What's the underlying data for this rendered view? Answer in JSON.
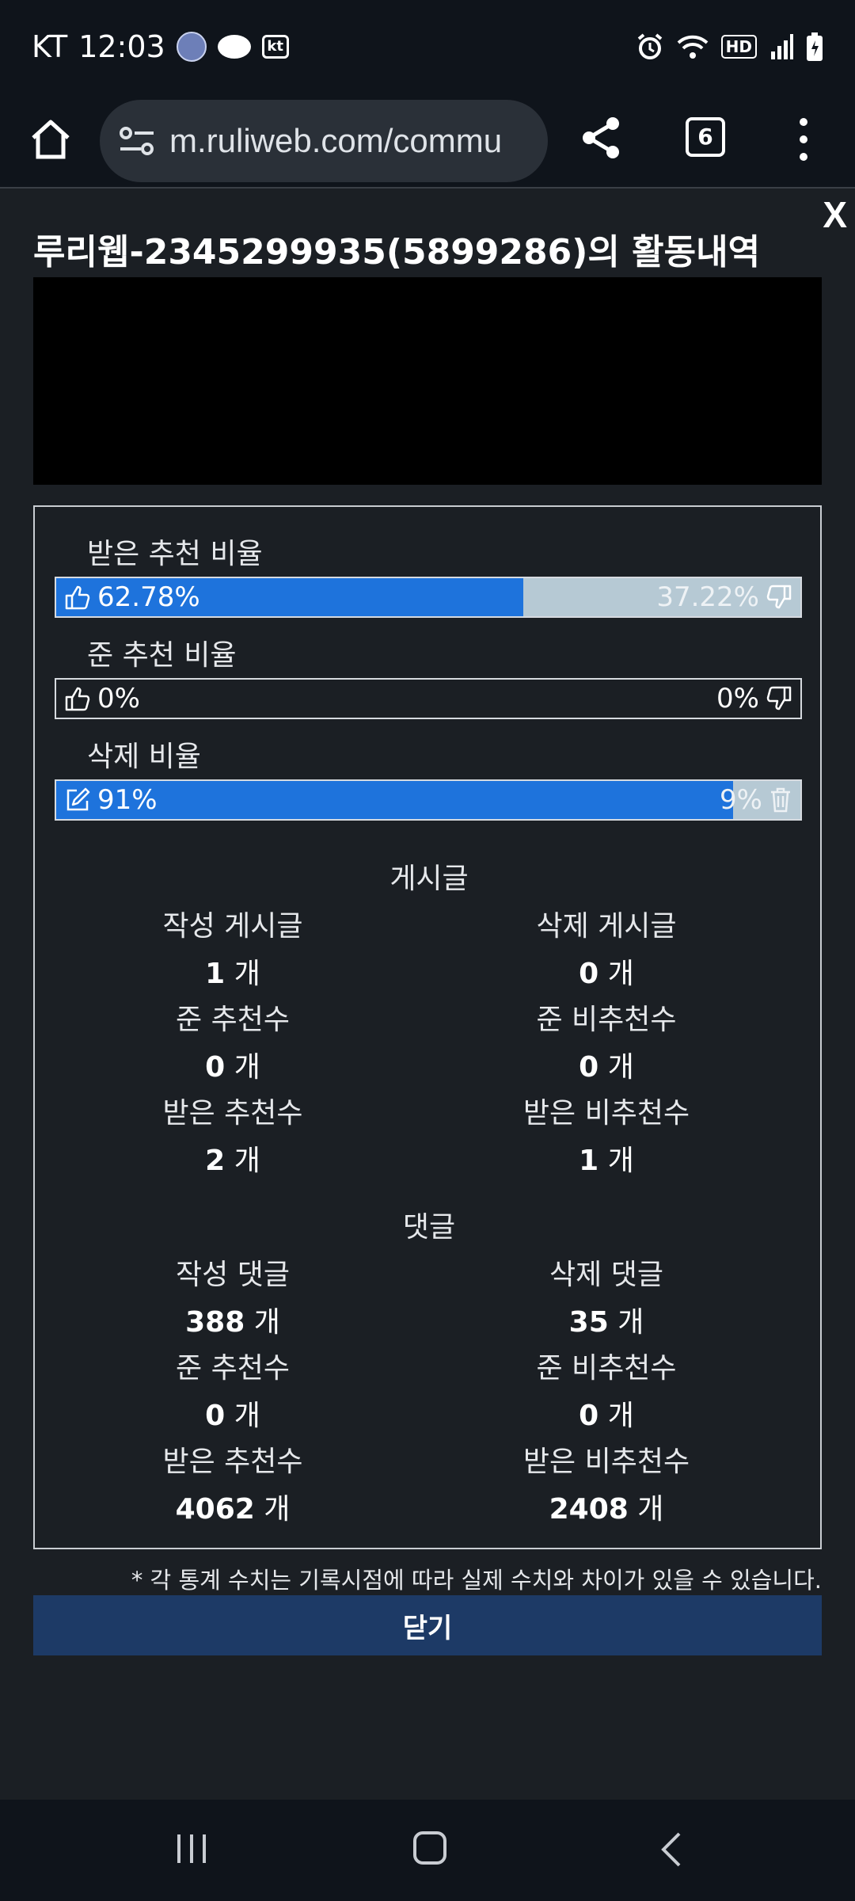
{
  "status_bar": {
    "carrier": "KT",
    "time": "12:03",
    "hd_badge": "HD",
    "kt_badge": "kt",
    "icons": [
      "avatar-icon",
      "message-icon",
      "kt-icon",
      "alarm-icon",
      "wifi-icon",
      "hd-icon",
      "signal-icon",
      "battery-icon"
    ]
  },
  "browser": {
    "url": "m.ruliweb.com/commu",
    "tab_count": "6",
    "icons": [
      "home-icon",
      "site-settings-icon",
      "share-icon",
      "tabs-icon",
      "more-menu-icon"
    ]
  },
  "popup": {
    "close_label": "X",
    "title": "루리웹-2345299935(5899286)의 활동내역",
    "ratios": [
      {
        "label": "받은 추천 비율",
        "left_value": "62.78%",
        "right_value": "37.22%",
        "left_fraction": 0.6278,
        "right_fraction": 0.3722,
        "left_icon": "thumbs-up-icon",
        "right_icon": "thumbs-down-icon"
      },
      {
        "label": "준 추천 비율",
        "left_value": "0%",
        "right_value": "0%",
        "left_fraction": 0,
        "right_fraction": 0,
        "left_icon": "thumbs-up-icon",
        "right_icon": "thumbs-down-icon"
      },
      {
        "label": "삭제 비율",
        "left_value": "91%",
        "right_value": "9%",
        "left_fraction": 0.91,
        "right_fraction": 0.09,
        "left_icon": "edit-icon",
        "right_icon": "trash-icon"
      }
    ],
    "unit": "개",
    "posts": {
      "heading": "게시글",
      "stats": [
        {
          "label": "작성 게시글",
          "value": "1"
        },
        {
          "label": "삭제 게시글",
          "value": "0"
        },
        {
          "label": "준 추천수",
          "value": "0"
        },
        {
          "label": "준 비추천수",
          "value": "0"
        },
        {
          "label": "받은 추천수",
          "value": "2"
        },
        {
          "label": "받은 비추천수",
          "value": "1"
        }
      ]
    },
    "comments": {
      "heading": "댓글",
      "stats": [
        {
          "label": "작성 댓글",
          "value": "388"
        },
        {
          "label": "삭제 댓글",
          "value": "35"
        },
        {
          "label": "준 추천수",
          "value": "0"
        },
        {
          "label": "준 비추천수",
          "value": "0"
        },
        {
          "label": "받은 추천수",
          "value": "4062"
        },
        {
          "label": "받은 비추천수",
          "value": "2408"
        }
      ]
    },
    "note": "* 각 통계 수치는 기록시점에 따라 실제 수치와 차이가 있을 수 있습니다.",
    "close_button": "닫기",
    "colors": {
      "bar_fill": "#1e73dc",
      "bar_rest": "#b6c9d4",
      "close_button_bg": "#1d3a66",
      "panel_bg": "#1b1f24"
    }
  },
  "nav_bar": {
    "icons": [
      "recent-apps-icon",
      "home-nav-icon",
      "back-icon"
    ]
  }
}
